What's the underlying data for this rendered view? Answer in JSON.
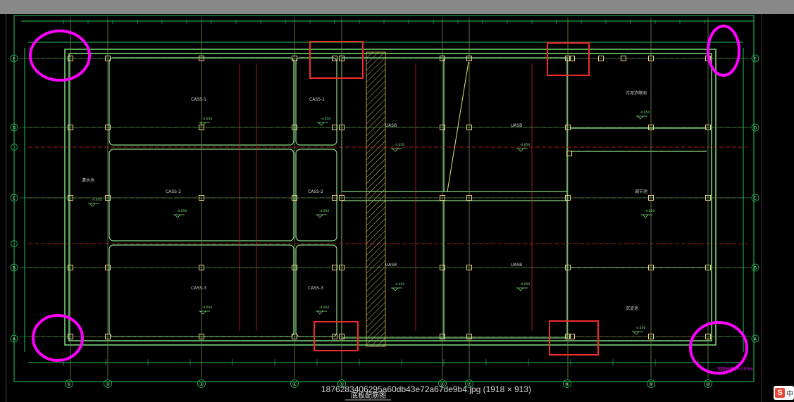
{
  "viewer": {
    "caption": "1876283406295a60db43e72a67de9b4.jpg (1918 × 913)",
    "ime_letter": "S",
    "ime_mode": "中"
  },
  "drawing": {
    "title": "底板配筋图",
    "axes_bottom": [
      "①",
      "②",
      "③",
      "④",
      "⑤",
      "⑥",
      "⑦",
      "⑧",
      "⑨",
      "⑩"
    ],
    "axes_side": [
      "E",
      "D",
      "C",
      "B",
      "A"
    ],
    "rooms": [
      {
        "label": "CASS-1",
        "sub": "-4.050"
      },
      {
        "label": "CASS-1",
        "sub": "-4.050"
      },
      {
        "label": "CASS-2",
        "sub": "-4.050"
      },
      {
        "label": "CASS-2",
        "sub": "-4.050"
      },
      {
        "label": "CASS-3",
        "sub": "-4.050"
      },
      {
        "label": "CASS-3",
        "sub": "-4.050"
      },
      {
        "label": "UASB",
        "sub": "-4.050"
      },
      {
        "label": "UASB",
        "sub": "-4.050"
      },
      {
        "label": "UASB",
        "sub": "-4.050"
      },
      {
        "label": "UASB",
        "sub": "-4.050"
      },
      {
        "label": "清水池",
        "sub": "-4.050"
      },
      {
        "label": "调节池",
        "sub": "-4.050"
      },
      {
        "label": "污泥浓缩池",
        "sub": "-4.050"
      },
      {
        "label": "沉淀池",
        "sub": "-4.050"
      }
    ],
    "note": "池底标高 -5.250m",
    "colors": {
      "grid": "#22c55e",
      "axis_red": "#dc2626",
      "markup_red": "#ef2b2b",
      "markup_magenta": "#ff00ff",
      "column": "#e8d28a",
      "hatch": "#d7c45a"
    }
  }
}
